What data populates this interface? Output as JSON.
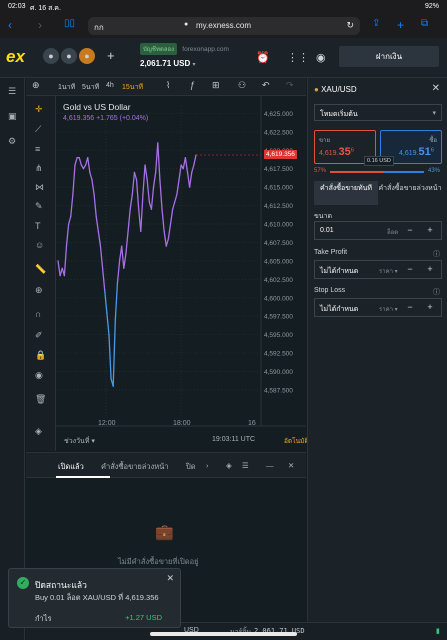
{
  "ios": {
    "time": "02:03",
    "date": "ศ. 16 ส.ค.",
    "battery": "92%"
  },
  "safari": {
    "aa": "กก",
    "url": "my.exness.com"
  },
  "header": {
    "logo": "ex",
    "account_type": "บัญชีทดลอง",
    "server": "forexonapp.com",
    "balance": "2,061.71 USD",
    "deposit_label": "ฝากเงิน"
  },
  "chart_toolbar": {
    "timeframes": [
      "1นาที",
      "5นาที",
      "4h",
      "15นาที"
    ],
    "active": "15นาที"
  },
  "chart_data": {
    "type": "line",
    "title": "Gold vs US Dollar",
    "quote": "4,619.356  +1.765 (+0.04%)",
    "current_price_tag": "4,619.356",
    "y_ticks": [
      "4,625.000",
      "4,622.500",
      "4,620.000",
      "4,617.500",
      "4,615.000",
      "4,612.500",
      "4,610.000",
      "4,607.500",
      "4,605.000",
      "4,602.500",
      "4,600.000",
      "4,597.500",
      "4,595.000",
      "4,592.500",
      "4,590.000",
      "4,587.500"
    ],
    "x_ticks": [
      "12:00",
      "18:00",
      "16"
    ],
    "ylim": [
      4586,
      4626
    ],
    "series": [
      {
        "color": "#a871e8",
        "low_color": "#4a9be8",
        "values": [
          4605,
          4603,
          4604,
          4603,
          4607,
          4610,
          4611,
          4614,
          4618,
          4619,
          4619,
          4618,
          4617.5,
          4618,
          4619,
          4617,
          4616,
          4614,
          4611,
          4609,
          4607,
          4604,
          4601,
          4598,
          4595,
          4589,
          4588,
          4597,
          4602,
          4605,
          4607,
          4604,
          4606,
          4609,
          4612,
          4614,
          4617,
          4616,
          4612,
          4609,
          4614,
          4618,
          4616,
          4613,
          4612,
          4615,
          4617,
          4621,
          4616,
          4612,
          4609,
          4607,
          4608,
          4610,
          4612,
          4613,
          4614,
          4616,
          4618,
          4617.5,
          4619,
          4617,
          4615,
          4617,
          4618,
          4619.356
        ]
      }
    ],
    "time_label": "19:03:11 UTC",
    "auto_label": "อัตโนมัติ",
    "range_label": "ช่วงวันที่"
  },
  "panel": {
    "symbol": "XAU/USD",
    "mode": "โหมดเริ่มต้น",
    "sell_label": "ขาย",
    "sell_price_small": "4,619.",
    "sell_price_big": "35",
    "sell_price_sup": "6",
    "buy_label": "ซื้อ",
    "buy_price_small": "4,619.",
    "buy_price_big": "51",
    "buy_price_sup": "6",
    "spread": "0.16 USD",
    "sell_pct": "57%",
    "buy_pct": "43%",
    "sell_pct_value": 57,
    "tab_market": "คำสั่งซื้อขายทันที",
    "tab_pending": "คำสั่งซื้อขายล่วงหน้า",
    "volume_label": "ขนาด",
    "volume_value": "0.01",
    "volume_unit": "ล็อต",
    "tp_label": "Take Profit",
    "tp_value": "ไม่ได้กำหนด",
    "tp_unit": "ราคา",
    "sl_label": "Stop Loss",
    "sl_value": "ไม่ได้กำหนด",
    "sl_unit": "ราคา"
  },
  "bottom": {
    "tab_open": "เปิดแล้ว",
    "tab_pending": "คำสั่งซื้อขายล่วงหน้า",
    "tab_closed": "ปิด",
    "empty_text": "ไม่มีคำสั่งซื้อขายที่เปิดอยู่"
  },
  "footer": {
    "currency": "USD",
    "margin_label": "มาร์จิ้น",
    "margin_value": "2,061.71 USD"
  },
  "toast": {
    "title": "ปิดสถานะแล้ว",
    "detail": "Buy 0.01 ล็อต XAU/USD ที่ 4,619.356",
    "profit_label": "กำไร",
    "profit_value": "+1.27 USD"
  }
}
